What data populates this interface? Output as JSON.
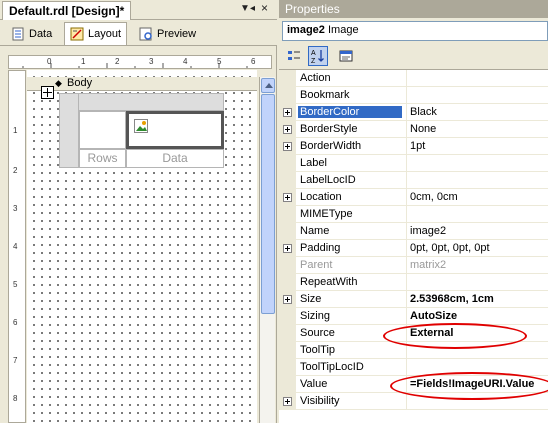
{
  "designer": {
    "doc_tab": "Default.rdl [Design]*",
    "tabs": [
      {
        "label": "Data",
        "icon": "data-icon"
      },
      {
        "label": "Layout",
        "icon": "layout-icon"
      },
      {
        "label": "Preview",
        "icon": "preview-icon"
      }
    ],
    "active_tab": "Layout",
    "ruler_top": [
      "0",
      "1",
      "2",
      "3",
      "4",
      "5",
      "6"
    ],
    "ruler_left": [
      "1",
      "2",
      "3",
      "4",
      "5",
      "6",
      "7",
      "8"
    ],
    "body_label": "Body",
    "matrix": {
      "rows_label": "Rows",
      "data_label": "Data"
    }
  },
  "properties": {
    "title": "Properties",
    "object_name": "image2",
    "object_type": "Image",
    "rows": [
      {
        "name": "Action",
        "value": "",
        "expandable": false
      },
      {
        "name": "Bookmark",
        "value": "",
        "expandable": false
      },
      {
        "name": "BorderColor",
        "value": "Black",
        "expandable": true,
        "selected": true
      },
      {
        "name": "BorderStyle",
        "value": "None",
        "expandable": true
      },
      {
        "name": "BorderWidth",
        "value": "1pt",
        "expandable": true
      },
      {
        "name": "Label",
        "value": "",
        "expandable": false
      },
      {
        "name": "LabelLocID",
        "value": "",
        "expandable": false
      },
      {
        "name": "Location",
        "value": "0cm, 0cm",
        "expandable": true
      },
      {
        "name": "MIMEType",
        "value": "",
        "expandable": false
      },
      {
        "name": "Name",
        "value": "image2",
        "expandable": false
      },
      {
        "name": "Padding",
        "value": "0pt, 0pt, 0pt, 0pt",
        "expandable": true
      },
      {
        "name": "Parent",
        "value": "matrix2",
        "expandable": false,
        "gray": true
      },
      {
        "name": "RepeatWith",
        "value": "",
        "expandable": false
      },
      {
        "name": "Size",
        "value": "2.53968cm, 1cm",
        "expandable": true,
        "bold": true
      },
      {
        "name": "Sizing",
        "value": "AutoSize",
        "expandable": false,
        "bold": true
      },
      {
        "name": "Source",
        "value": "External",
        "expandable": false,
        "bold": true
      },
      {
        "name": "ToolTip",
        "value": "",
        "expandable": false
      },
      {
        "name": "ToolTipLocID",
        "value": "",
        "expandable": false
      },
      {
        "name": "Value",
        "value": "=Fields!ImageURI.Value",
        "expandable": false,
        "bold": true
      },
      {
        "name": "Visibility",
        "value": "",
        "expandable": true
      }
    ]
  },
  "colors": {
    "highlight": "#E00000",
    "selection": "#316AC5",
    "chrome": "#ECE9D8"
  }
}
